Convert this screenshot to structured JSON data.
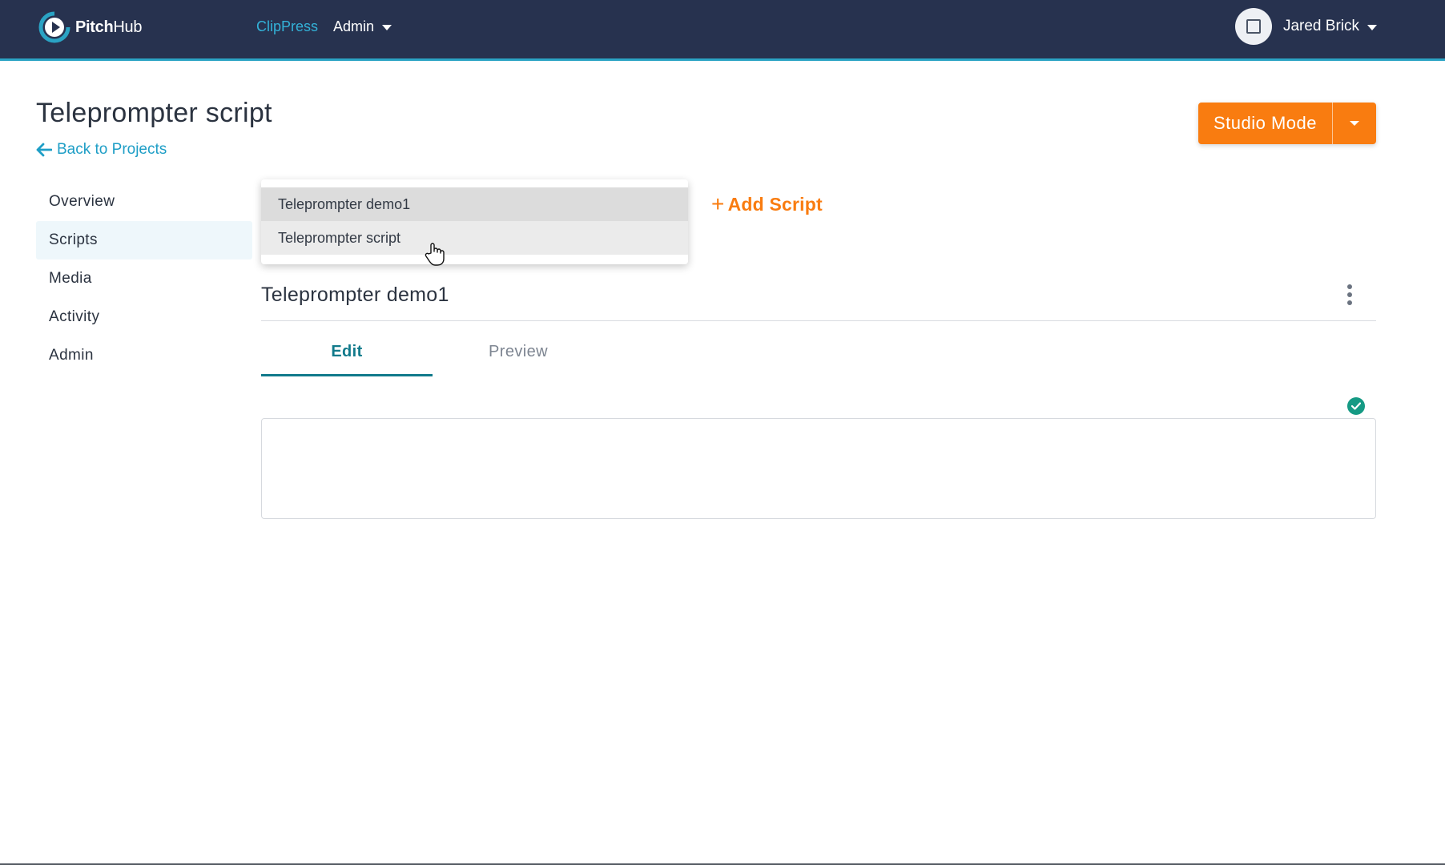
{
  "topbar": {
    "logo": {
      "brand": "Pitch",
      "brand_suffix": "Hub"
    },
    "nav": [
      {
        "label": "ClipPress",
        "active": true
      },
      {
        "label": "Admin",
        "has_dropdown": true
      }
    ],
    "user": {
      "name": "Jared Brick"
    }
  },
  "header": {
    "title": "Teleprompter script",
    "back_label": "Back to Projects",
    "studio_button": "Studio Mode"
  },
  "sidebar": {
    "items": [
      {
        "label": "Overview",
        "active": false
      },
      {
        "label": "Scripts",
        "active": true
      },
      {
        "label": "Media",
        "active": false
      },
      {
        "label": "Activity",
        "active": false
      },
      {
        "label": "Admin",
        "active": false
      }
    ]
  },
  "main": {
    "script_select": {
      "options": [
        "Teleprompter demo1",
        "Teleprompter script"
      ],
      "selected": "Teleprompter demo1",
      "hovered": "Teleprompter script"
    },
    "add_script_label": "Add Script",
    "current_script_title": "Teleprompter demo1",
    "tabs": [
      {
        "label": "Edit",
        "active": true
      },
      {
        "label": "Preview",
        "active": false
      }
    ],
    "editor_content": ""
  },
  "colors": {
    "topbar_bg": "#27324f",
    "accent_teal": "#117a8b",
    "link_blue": "#1e9ec6",
    "orange": "#f97c10",
    "saved_green": "#159a84"
  },
  "icons": [
    "pitchhub-logo-icon",
    "chevron-down-icon",
    "avatar-icon",
    "arrow-left-icon",
    "plus-icon",
    "more-vertical-icon",
    "check-circle-icon",
    "hand-cursor-icon"
  ]
}
